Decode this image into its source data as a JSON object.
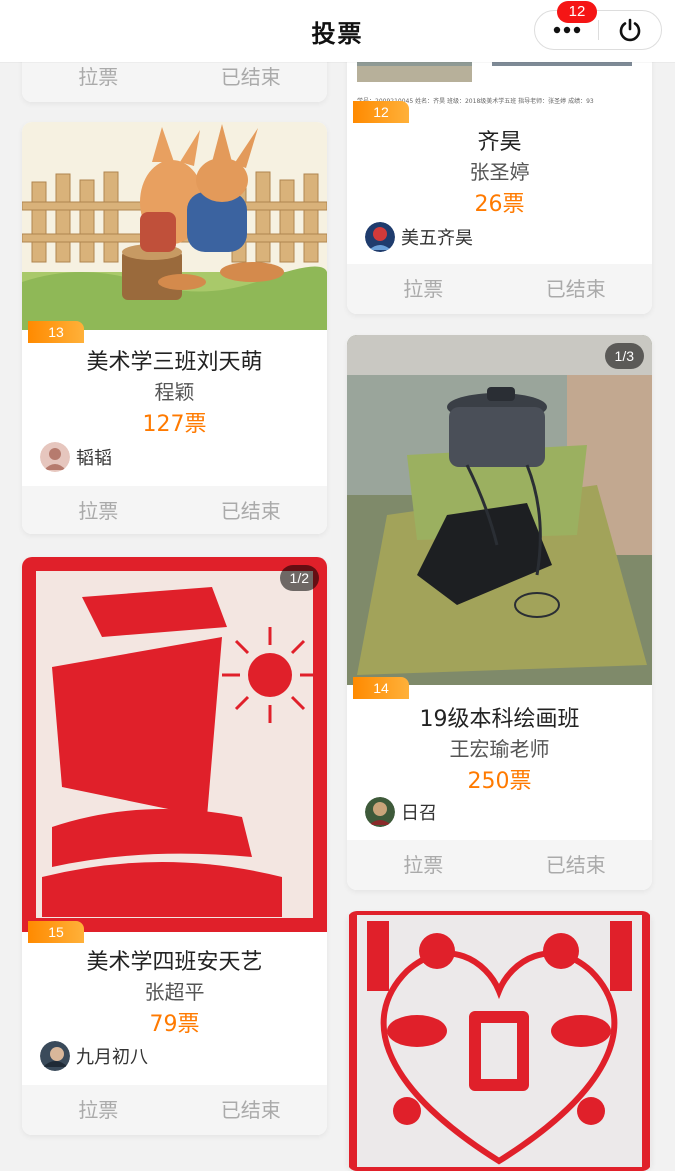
{
  "header": {
    "title": "投票",
    "notification_count": "12"
  },
  "cards": [
    {
      "action_label": "拉票",
      "status_label": "已结束"
    },
    {
      "number": "13",
      "name": "美术学三班刘天萌",
      "teacher": "程颖",
      "votes": "127票",
      "user": "韬韬",
      "action_label": "拉票",
      "status_label": "已结束"
    },
    {
      "number": "15",
      "pager": "1/2",
      "name": "美术学四班安天艺",
      "teacher": "张超平",
      "votes": "79票",
      "user": "九月初八",
      "action_label": "拉票",
      "status_label": "已结束"
    },
    {
      "number": "12",
      "name": "齐昊",
      "teacher": "张圣婷",
      "votes": "26票",
      "user": "美五齐昊",
      "action_label": "拉票",
      "status_label": "已结束",
      "caption": "学号：2009210045  姓名：齐昊  班级：2018级美术学五班  指导老师：张圣婷  成绩：93"
    },
    {
      "number": "14",
      "pager": "1/3",
      "name": "19级本科绘画班",
      "teacher": "王宏瑜老师",
      "votes": "250票",
      "user": "日召",
      "action_label": "拉票",
      "status_label": "已结束"
    },
    {}
  ],
  "colors": {
    "accent": "#ff7a00",
    "badge": "#f51515",
    "paper_cut_red": "#e0202a"
  }
}
